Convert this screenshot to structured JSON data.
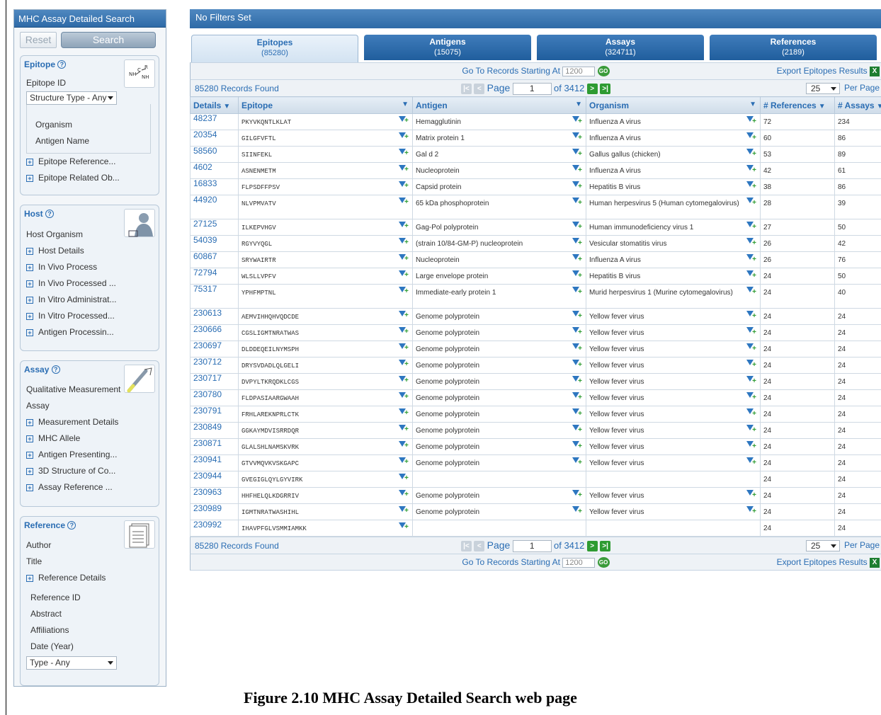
{
  "sidebar": {
    "title": "MHC Assay Detailed Search",
    "reset": "Reset",
    "search": "Search",
    "epitope": {
      "header": "Epitope",
      "epitope_id": "Epitope ID",
      "structure_type": "Structure Type - Any",
      "organism": "Organism",
      "antigen_name": "Antigen Name",
      "items": [
        "Epitope Reference...",
        "Epitope Related Ob..."
      ]
    },
    "host": {
      "header": "Host",
      "host_organism": "Host Organism",
      "items": [
        "Host Details",
        "In Vivo Process",
        "In Vivo Processed ...",
        "In Vitro Administrat...",
        "In Vitro Processed...",
        "Antigen Processin..."
      ]
    },
    "assay": {
      "header": "Assay",
      "qual": "Qualitative Measurement",
      "assay": "Assay",
      "items": [
        "Measurement Details",
        "MHC Allele",
        "Antigen Presenting...",
        "3D Structure of Co...",
        "Assay Reference ..."
      ]
    },
    "reference": {
      "header": "Reference",
      "author": "Author",
      "title": "Title",
      "details": "Reference Details",
      "ref_id": "Reference ID",
      "abstract": "Abstract",
      "affiliations": "Affiliations",
      "date": "Date (Year)",
      "type": "Type - Any"
    }
  },
  "main": {
    "filters": "No Filters Set",
    "tabs": [
      {
        "label": "Epitopes",
        "count": "(85280)"
      },
      {
        "label": "Antigens",
        "count": "(15075)"
      },
      {
        "label": "Assays",
        "count": "(324711)"
      },
      {
        "label": "References",
        "count": "(2189)"
      }
    ],
    "goto": "Go To Records Starting At",
    "goto_value": "1200",
    "go": "GO",
    "export": "Export Epitopes Results",
    "records": "85280 Records Found",
    "page_label": "Page",
    "page_value": "1",
    "of_pages": "of 3412",
    "per_page_value": "25",
    "per_page": "Per Page",
    "columns": [
      "Details",
      "Epitope",
      "Antigen",
      "Organism",
      "# References",
      "# Assays"
    ],
    "rows": [
      {
        "id": "48237",
        "seq": "PKYVKQNTLKLAT",
        "antigen": "Hemagglutinin",
        "organism": "Influenza A virus",
        "refs": "72",
        "assays": "234"
      },
      {
        "id": "20354",
        "seq": "GILGFVFTL",
        "antigen": "Matrix protein 1",
        "organism": "Influenza A virus",
        "refs": "60",
        "assays": "86"
      },
      {
        "id": "58560",
        "seq": "SIINFEKL",
        "antigen": "Gal d 2",
        "organism": "Gallus gallus (chicken)",
        "refs": "53",
        "assays": "89"
      },
      {
        "id": "4602",
        "seq": "ASNENMETM",
        "antigen": "Nucleoprotein",
        "organism": "Influenza A virus",
        "refs": "42",
        "assays": "61"
      },
      {
        "id": "16833",
        "seq": "FLPSDFFPSV",
        "antigen": "Capsid protein",
        "organism": "Hepatitis B virus",
        "refs": "38",
        "assays": "86"
      },
      {
        "id": "44920",
        "seq": "NLVPMVATV",
        "antigen": "65 kDa phosphoprotein",
        "organism": "Human herpesvirus 5 (Human cytomegalovirus)",
        "refs": "28",
        "assays": "39"
      },
      {
        "id": "27125",
        "seq": "ILKEPVHGV",
        "antigen": "Gag-Pol polyprotein",
        "organism": "Human immunodeficiency virus 1",
        "refs": "27",
        "assays": "50"
      },
      {
        "id": "54039",
        "seq": "RGYVYQGL",
        "antigen": "(strain 10/84-GM-P) nucleoprotein",
        "organism": "Vesicular stomatitis virus",
        "refs": "26",
        "assays": "42"
      },
      {
        "id": "60867",
        "seq": "SRYWAIRTR",
        "antigen": "Nucleoprotein",
        "organism": "Influenza A virus",
        "refs": "26",
        "assays": "76"
      },
      {
        "id": "72794",
        "seq": "WLSLLVPFV",
        "antigen": "Large envelope protein",
        "organism": "Hepatitis B virus",
        "refs": "24",
        "assays": "50"
      },
      {
        "id": "75317",
        "seq": "YPHFMPTNL",
        "antigen": "Immediate-early protein 1",
        "organism": "Murid herpesvirus 1 (Murine cytomegalovirus)",
        "refs": "24",
        "assays": "40"
      },
      {
        "id": "230613",
        "seq": "AEMVIHHQHVQDCDE",
        "antigen": "Genome polyprotein",
        "organism": "Yellow fever virus",
        "refs": "24",
        "assays": "24"
      },
      {
        "id": "230666",
        "seq": "CGSLIGMTNRATWAS",
        "antigen": "Genome polyprotein",
        "organism": "Yellow fever virus",
        "refs": "24",
        "assays": "24"
      },
      {
        "id": "230697",
        "seq": "DLDDEQEILNYMSPH",
        "antigen": "Genome polyprotein",
        "organism": "Yellow fever virus",
        "refs": "24",
        "assays": "24"
      },
      {
        "id": "230712",
        "seq": "DRYSVDADLQLGELI",
        "antigen": "Genome polyprotein",
        "organism": "Yellow fever virus",
        "refs": "24",
        "assays": "24"
      },
      {
        "id": "230717",
        "seq": "DVPYLTKRQDKLCGS",
        "antigen": "Genome polyprotein",
        "organism": "Yellow fever virus",
        "refs": "24",
        "assays": "24"
      },
      {
        "id": "230780",
        "seq": "FLDPASIAARGWAAH",
        "antigen": "Genome polyprotein",
        "organism": "Yellow fever virus",
        "refs": "24",
        "assays": "24"
      },
      {
        "id": "230791",
        "seq": "FRHLAREKNPRLCTK",
        "antigen": "Genome polyprotein",
        "organism": "Yellow fever virus",
        "refs": "24",
        "assays": "24"
      },
      {
        "id": "230849",
        "seq": "GGKAYMDVISRRDQR",
        "antigen": "Genome polyprotein",
        "organism": "Yellow fever virus",
        "refs": "24",
        "assays": "24"
      },
      {
        "id": "230871",
        "seq": "GLALSHLNAMSKVRK",
        "antigen": "Genome polyprotein",
        "organism": "Yellow fever virus",
        "refs": "24",
        "assays": "24"
      },
      {
        "id": "230941",
        "seq": "GTVVMQVKVSKGAPC",
        "antigen": "Genome polyprotein",
        "organism": "Yellow fever virus",
        "refs": "24",
        "assays": "24"
      },
      {
        "id": "230944",
        "seq": "GVEGIGLQYLGYVIRK",
        "antigen": "",
        "organism": "",
        "refs": "24",
        "assays": "24"
      },
      {
        "id": "230963",
        "seq": "HHFHELQLKDGRRIV",
        "antigen": "Genome polyprotein",
        "organism": "Yellow fever virus",
        "refs": "24",
        "assays": "24"
      },
      {
        "id": "230989",
        "seq": "IGMTNRATWASHIHL",
        "antigen": "Genome polyprotein",
        "organism": "Yellow fever virus",
        "refs": "24",
        "assays": "24"
      },
      {
        "id": "230992",
        "seq": "IHAVPFGLVSMMIAMKK",
        "antigen": "",
        "organism": "",
        "refs": "24",
        "assays": "24"
      }
    ]
  },
  "caption": "Figure 2.10  MHC Assay Detailed Search web page"
}
